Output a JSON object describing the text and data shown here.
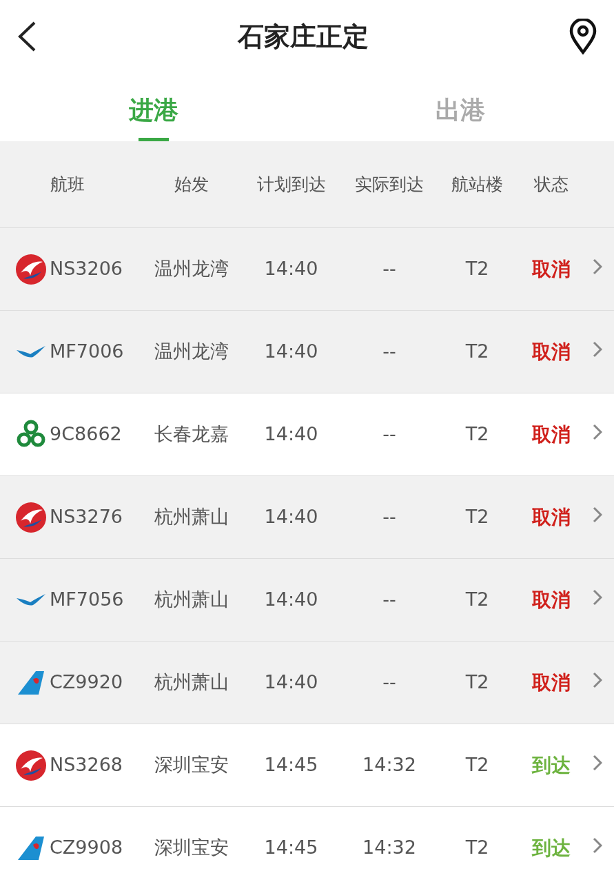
{
  "header": {
    "title": "石家庄正定"
  },
  "tabs": [
    {
      "label": "进港",
      "selected": true
    },
    {
      "label": "出港",
      "selected": false
    }
  ],
  "columns": [
    "航班",
    "始发",
    "计划到达",
    "实际到达",
    "航站楼",
    "状态"
  ],
  "rows": [
    {
      "kind": "red-circle",
      "flight": "NS3206",
      "origin": "温州龙湾",
      "planned": "14:40",
      "actual": "--",
      "terminal": "T2",
      "status": "取消",
      "color": "#d0201b",
      "shaded": true
    },
    {
      "kind": "blue-bird",
      "flight": "MF7006",
      "origin": "温州龙湾",
      "planned": "14:40",
      "actual": "--",
      "terminal": "T2",
      "status": "取消",
      "color": "#d0201b",
      "shaded": true
    },
    {
      "kind": "green-knot",
      "flight": "9C8662",
      "origin": "长春龙嘉",
      "planned": "14:40",
      "actual": "--",
      "terminal": "T2",
      "status": "取消",
      "color": "#d0201b",
      "shaded": false
    },
    {
      "kind": "red-circle",
      "flight": "NS3276",
      "origin": "杭州萧山",
      "planned": "14:40",
      "actual": "--",
      "terminal": "T2",
      "status": "取消",
      "color": "#d0201b",
      "shaded": true
    },
    {
      "kind": "blue-bird",
      "flight": "MF7056",
      "origin": "杭州萧山",
      "planned": "14:40",
      "actual": "--",
      "terminal": "T2",
      "status": "取消",
      "color": "#d0201b",
      "shaded": true
    },
    {
      "kind": "blue-tail",
      "flight": "CZ9920",
      "origin": "杭州萧山",
      "planned": "14:40",
      "actual": "--",
      "terminal": "T2",
      "status": "取消",
      "color": "#d0201b",
      "shaded": true
    },
    {
      "kind": "red-circle",
      "flight": "NS3268",
      "origin": "深圳宝安",
      "planned": "14:45",
      "actual": "14:32",
      "terminal": "T2",
      "status": "到达",
      "color": "#6db33f",
      "shaded": false
    },
    {
      "kind": "blue-tail",
      "flight": "CZ9908",
      "origin": "深圳宝安",
      "planned": "14:45",
      "actual": "14:32",
      "terminal": "T2",
      "status": "到达",
      "color": "#6db33f",
      "shaded": false
    }
  ]
}
